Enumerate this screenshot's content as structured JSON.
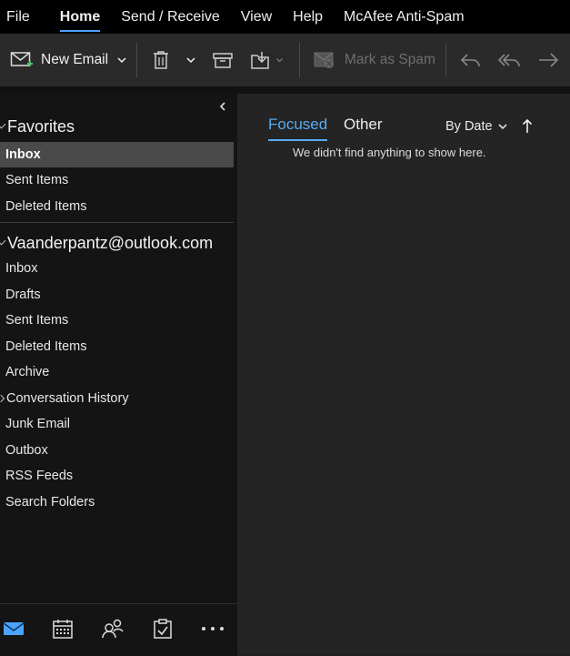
{
  "menu": {
    "items": [
      "File",
      "Home",
      "Send / Receive",
      "View",
      "Help",
      "McAfee Anti-Spam"
    ],
    "active": "Home"
  },
  "ribbon": {
    "new_email_label": "New Email",
    "mark_spam_label": "Mark as Spam"
  },
  "sidebar": {
    "favorites_label": "Favorites",
    "favorites": [
      "Inbox",
      "Sent Items",
      "Deleted Items"
    ],
    "selected": "Inbox",
    "account_label": "Vaanderpantz@outlook.com",
    "account_folders": [
      "Inbox",
      "Drafts",
      "Sent Items",
      "Deleted Items",
      "Archive",
      "Conversation History",
      "Junk Email",
      "Outbox",
      "RSS Feeds",
      "Search Folders"
    ]
  },
  "message_list": {
    "tab_focused": "Focused",
    "tab_other": "Other",
    "sort_label": "By Date",
    "empty_message": "We didn't find anything to show here."
  },
  "bottom_nav": {
    "icons": [
      "mail-icon",
      "calendar-icon",
      "people-icon",
      "tasks-icon",
      "more-icon"
    ]
  },
  "colors": {
    "accent": "#4aa3ff",
    "background": "#1f1f1f"
  }
}
